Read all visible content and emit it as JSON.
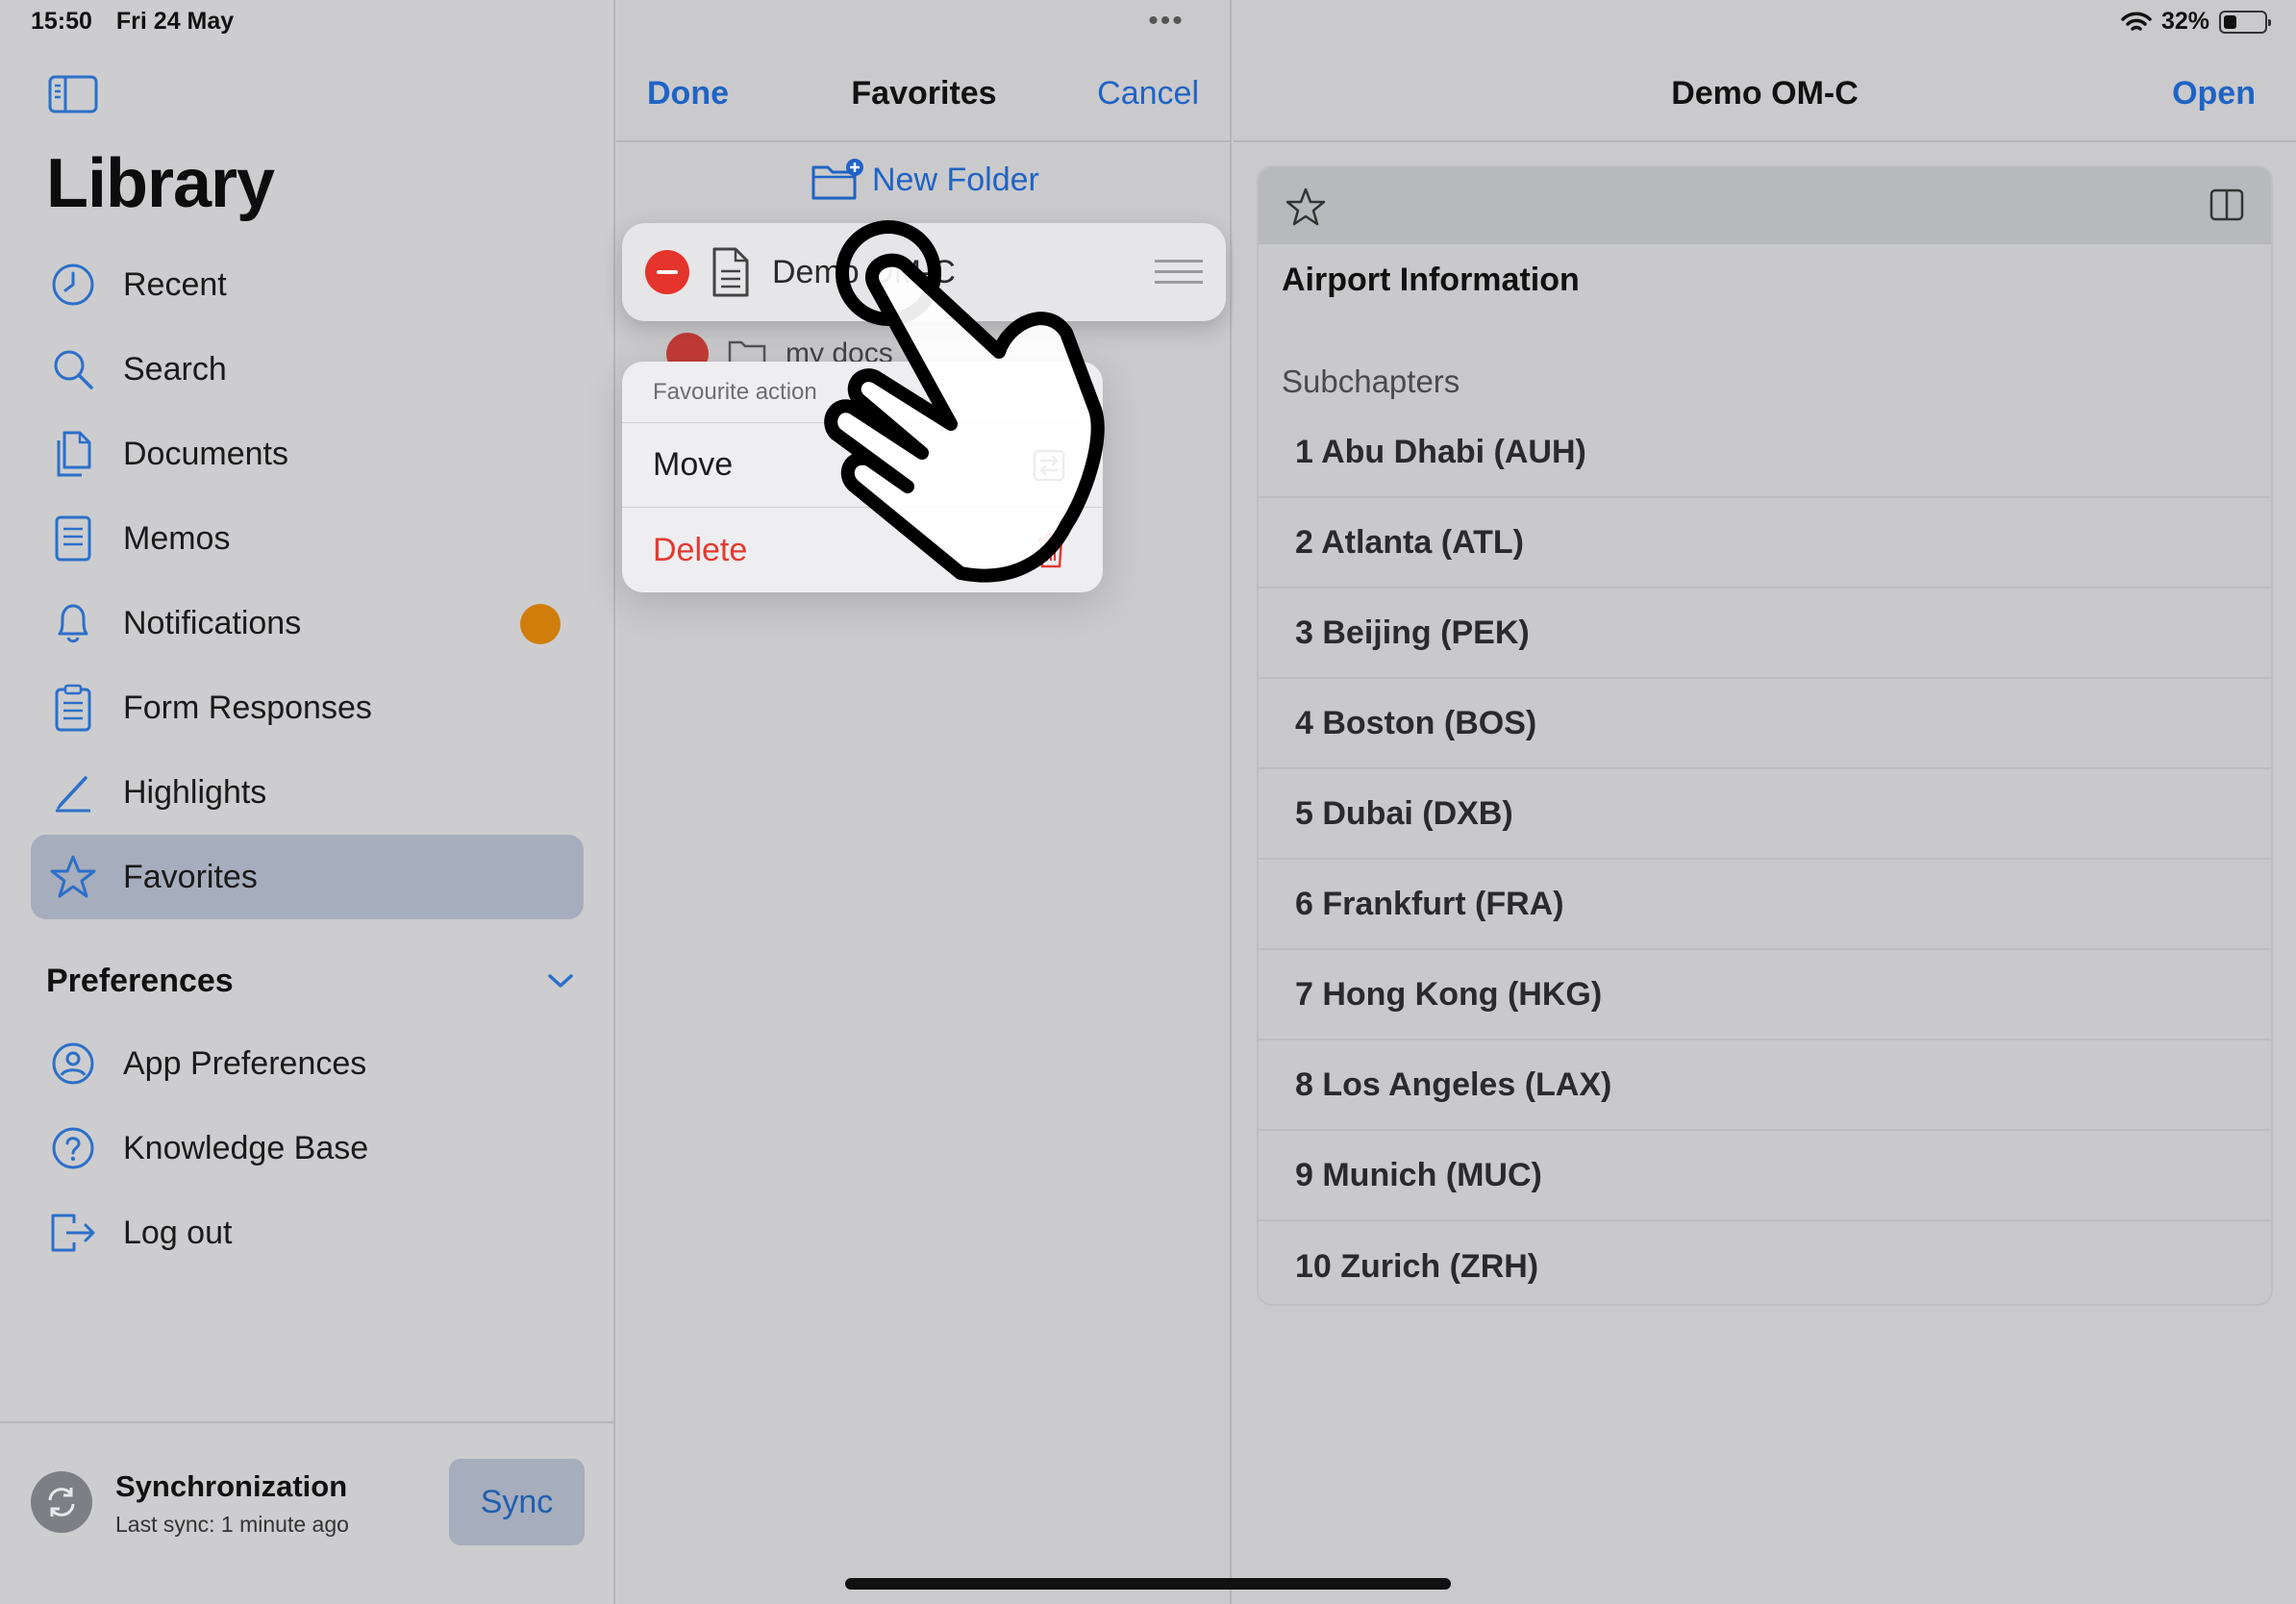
{
  "status_bar": {
    "time": "15:50",
    "date": "Fri 24 May",
    "battery_text": "32%",
    "battery_level": 0.32
  },
  "sidebar": {
    "title": "Library",
    "items": [
      {
        "label": "Recent",
        "icon": "clock-icon"
      },
      {
        "label": "Search",
        "icon": "magnifier-icon"
      },
      {
        "label": "Documents",
        "icon": "documents-icon"
      },
      {
        "label": "Memos",
        "icon": "memo-icon"
      },
      {
        "label": "Notifications",
        "icon": "bell-icon",
        "badge": true
      },
      {
        "label": "Form Responses",
        "icon": "clipboard-icon"
      },
      {
        "label": "Highlights",
        "icon": "pen-icon"
      },
      {
        "label": "Favorites",
        "icon": "star-icon",
        "selected": true
      }
    ],
    "preferences_header": "Preferences",
    "preferences_items": [
      {
        "label": "App Preferences",
        "icon": "person-circle-icon"
      },
      {
        "label": "Knowledge Base",
        "icon": "question-circle-icon"
      },
      {
        "label": "Log out",
        "icon": "logout-icon"
      }
    ],
    "sync": {
      "title": "Synchronization",
      "subtitle": "Last sync: 1 minute ago",
      "button": "Sync"
    }
  },
  "middle": {
    "done": "Done",
    "title": "Favorites",
    "cancel": "Cancel",
    "new_folder": "New Folder",
    "lifted_row": "Demo OM-C",
    "under_row": "my docs",
    "menu": {
      "title": "Favourite action",
      "move": "Move",
      "delete": "Delete"
    }
  },
  "right": {
    "title": "Demo OM-C",
    "open": "Open",
    "section_title": "Airport Information",
    "subchapters_label": "Subchapters",
    "chapters": [
      "1 Abu Dhabi (AUH)",
      "2 Atlanta (ATL)",
      "3 Beijing (PEK)",
      "4 Boston (BOS)",
      "5 Dubai (DXB)",
      "6 Frankfurt (FRA)",
      "7 Hong Kong (HKG)",
      "8 Los Angeles (LAX)",
      "9 Munich (MUC)",
      "10 Zurich (ZRH)"
    ]
  },
  "colors": {
    "accent": "#1f63c4",
    "destructive": "#e23a31",
    "badge": "#d17d0c",
    "selected_bg": "#a6adbc"
  }
}
